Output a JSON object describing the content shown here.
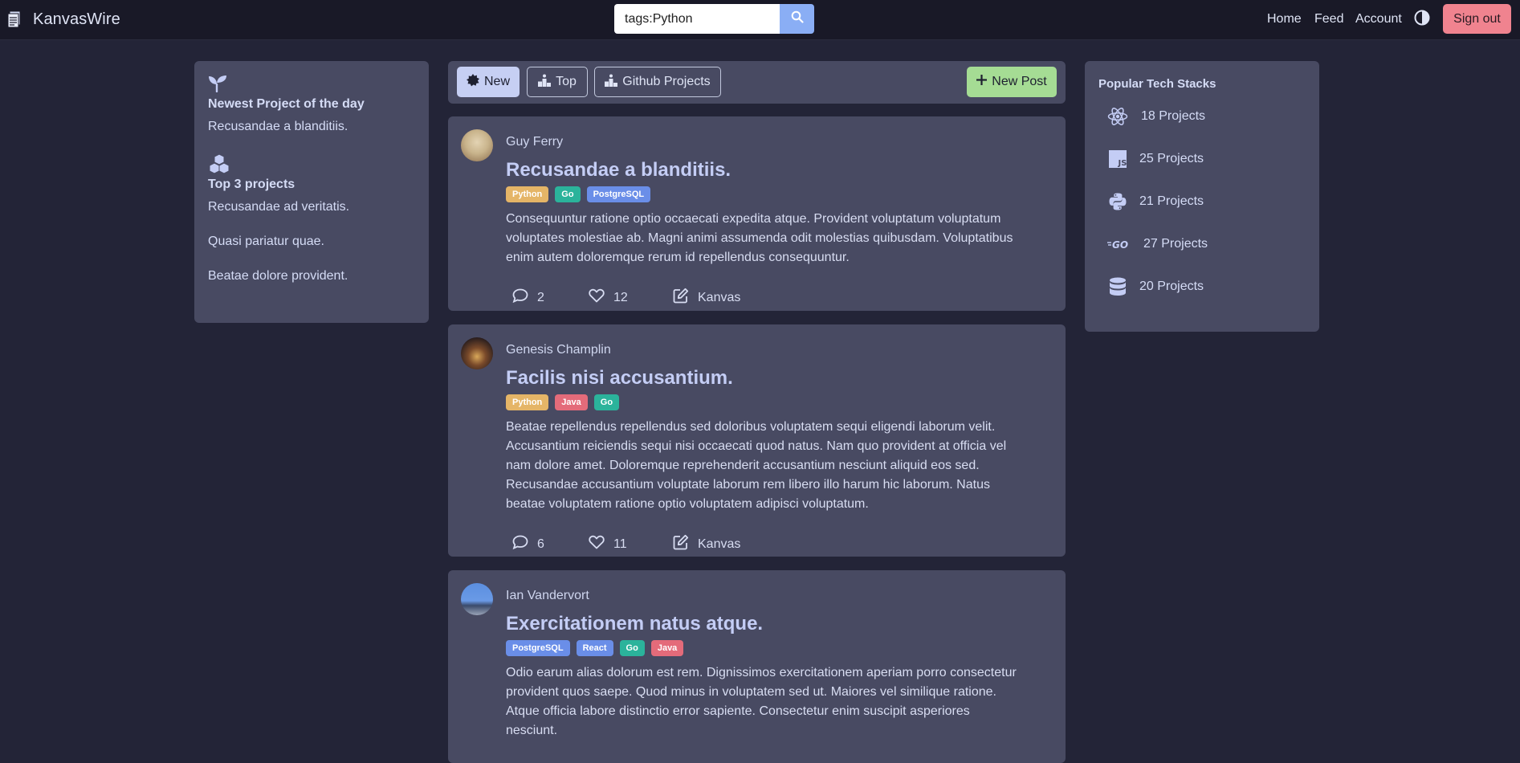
{
  "navbar": {
    "brand": "KanvasWire",
    "search_value": "tags:Python",
    "links": [
      "Home",
      "Feed",
      "Account"
    ],
    "signout_label": "Sign out"
  },
  "left_sidebar": {
    "newest_title": "Newest Project of the day",
    "newest_item": "Recusandae a blanditiis.",
    "top_title": "Top 3 projects",
    "top_items": [
      "Recusandae ad veritatis.",
      "Quasi pariatur quae.",
      "Beatae dolore provident."
    ]
  },
  "tabs": {
    "new_label": "New",
    "top_label": "Top",
    "github_label": "Github Projects",
    "new_post_label": "New Post"
  },
  "tag_colors": {
    "Python": "#e5b567",
    "Go": "#2bb39b",
    "PostgreSQL": "#6a8ee8",
    "Java": "#e46b7a",
    "React": "#6a8ee8"
  },
  "posts": [
    {
      "author": "Guy Ferry",
      "title": "Recusandae a blanditiis.",
      "tags": [
        "Python",
        "Go",
        "PostgreSQL"
      ],
      "body": "Consequuntur ratione optio occaecati expedita atque. Provident voluptatum voluptatum voluptates molestiae ab. Magni animi assumenda odit molestias quibusdam. Voluptatibus enim autem doloremque rerum id repellendus consequuntur.",
      "comments": "2",
      "likes": "12",
      "edit_label": "Kanvas"
    },
    {
      "author": "Genesis Champlin",
      "title": "Facilis nisi accusantium.",
      "tags": [
        "Python",
        "Java",
        "Go"
      ],
      "body": "Beatae repellendus repellendus sed doloribus voluptatem sequi eligendi laborum velit. Accusantium reiciendis sequi nisi occaecati quod natus. Nam quo provident at officia vel nam dolore amet. Doloremque reprehenderit accusantium nesciunt aliquid eos sed. Recusandae accusantium voluptate laborum rem libero illo harum hic laborum. Natus beatae voluptatem ratione optio voluptatem adipisci voluptatum.",
      "comments": "6",
      "likes": "11",
      "edit_label": "Kanvas"
    },
    {
      "author": "Ian Vandervort",
      "title": "Exercitationem natus atque.",
      "tags": [
        "PostgreSQL",
        "React",
        "Go",
        "Java"
      ],
      "body": "Odio earum alias dolorum est rem. Dignissimos exercitationem aperiam porro consectetur provident quos saepe. Quod minus in voluptatem sed ut. Maiores vel similique ratione. Atque officia labore distinctio error sapiente. Consectetur enim suscipit asperiores nesciunt."
    }
  ],
  "right_sidebar": {
    "title": "Popular Tech Stacks",
    "stacks": [
      {
        "icon": "react-icon",
        "label": "18 Projects"
      },
      {
        "icon": "javascript-icon",
        "label": "25 Projects"
      },
      {
        "icon": "python-icon",
        "label": "21 Projects"
      },
      {
        "icon": "go-icon",
        "label": "27 Projects"
      },
      {
        "icon": "database-icon",
        "label": "20 Projects"
      }
    ]
  }
}
